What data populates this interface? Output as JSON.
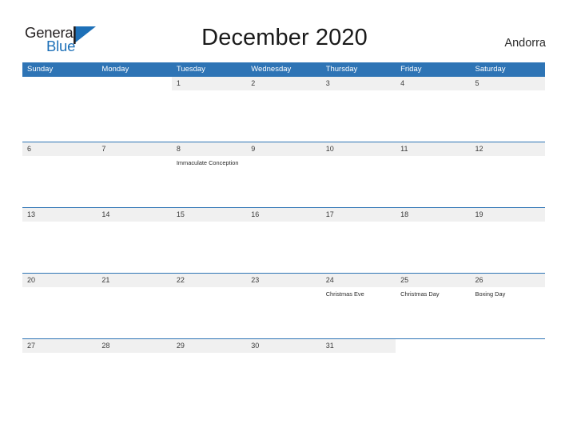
{
  "brand": {
    "name_part1": "General",
    "name_part2": "Blue",
    "triangle_color": "#1d70b8",
    "text_color": "#231f20"
  },
  "header": {
    "title": "December 2020",
    "country": "Andorra"
  },
  "theme": {
    "header_blue": "#2e74b5",
    "row_gray": "#f0f0f0",
    "background": "#ffffff",
    "text": "#2b2b2b"
  },
  "calendar": {
    "weekdays": [
      "Sunday",
      "Monday",
      "Tuesday",
      "Wednesday",
      "Thursday",
      "Friday",
      "Saturday"
    ],
    "weeks": [
      [
        {
          "day": "",
          "events": []
        },
        {
          "day": "",
          "events": []
        },
        {
          "day": "1",
          "events": []
        },
        {
          "day": "2",
          "events": []
        },
        {
          "day": "3",
          "events": []
        },
        {
          "day": "4",
          "events": []
        },
        {
          "day": "5",
          "events": []
        }
      ],
      [
        {
          "day": "6",
          "events": []
        },
        {
          "day": "7",
          "events": []
        },
        {
          "day": "8",
          "events": [
            "Immaculate Conception"
          ]
        },
        {
          "day": "9",
          "events": []
        },
        {
          "day": "10",
          "events": []
        },
        {
          "day": "11",
          "events": []
        },
        {
          "day": "12",
          "events": []
        }
      ],
      [
        {
          "day": "13",
          "events": []
        },
        {
          "day": "14",
          "events": []
        },
        {
          "day": "15",
          "events": []
        },
        {
          "day": "16",
          "events": []
        },
        {
          "day": "17",
          "events": []
        },
        {
          "day": "18",
          "events": []
        },
        {
          "day": "19",
          "events": []
        }
      ],
      [
        {
          "day": "20",
          "events": []
        },
        {
          "day": "21",
          "events": []
        },
        {
          "day": "22",
          "events": []
        },
        {
          "day": "23",
          "events": []
        },
        {
          "day": "24",
          "events": [
            "Christmas Eve"
          ]
        },
        {
          "day": "25",
          "events": [
            "Christmas Day"
          ]
        },
        {
          "day": "26",
          "events": [
            "Boxing Day"
          ]
        }
      ],
      [
        {
          "day": "27",
          "events": []
        },
        {
          "day": "28",
          "events": []
        },
        {
          "day": "29",
          "events": []
        },
        {
          "day": "30",
          "events": []
        },
        {
          "day": "31",
          "events": []
        },
        {
          "day": "",
          "events": []
        },
        {
          "day": "",
          "events": []
        }
      ]
    ]
  }
}
